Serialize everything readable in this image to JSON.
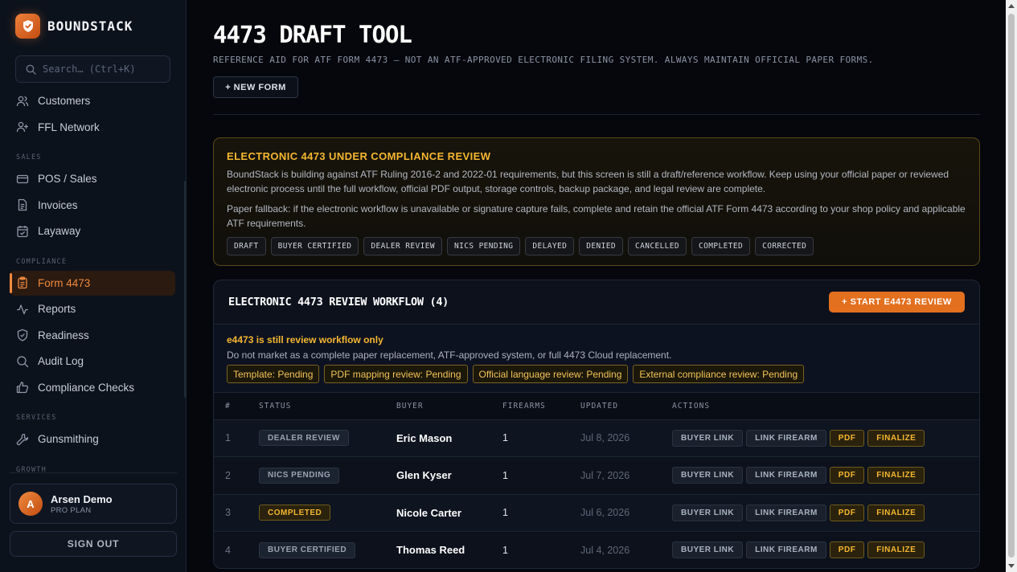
{
  "brand": {
    "name": "BOUNDSTACK"
  },
  "search": {
    "placeholder": "Search… (Ctrl+K)"
  },
  "nav": {
    "customers": "Customers",
    "ffl_network": "FFL Network",
    "section_sales": "SALES",
    "pos": "POS / Sales",
    "invoices": "Invoices",
    "layaway": "Layaway",
    "section_compliance": "COMPLIANCE",
    "form4473": "Form 4473",
    "reports": "Reports",
    "readiness": "Readiness",
    "audit_log": "Audit Log",
    "compliance_checks": "Compliance Checks",
    "section_services": "SERVICES",
    "gunsmithing": "Gunsmithing",
    "section_growth": "GROWTH"
  },
  "user": {
    "initial": "A",
    "name": "Arsen Demo",
    "plan": "PRO PLAN",
    "signout": "SIGN OUT"
  },
  "page": {
    "title": "4473 DRAFT TOOL",
    "subtitle": "REFERENCE AID FOR ATF FORM 4473 — NOT AN ATF-APPROVED ELECTRONIC FILING SYSTEM. ALWAYS MAINTAIN OFFICIAL PAPER FORMS.",
    "new_form": "+ NEW FORM"
  },
  "review_banner": {
    "title": "ELECTRONIC 4473 UNDER COMPLIANCE REVIEW",
    "text1": "BoundStack is building against ATF Ruling 2016-2 and 2022-01 requirements, but this screen is still a draft/reference workflow. Keep using your official paper or reviewed electronic process until the full workflow, official PDF output, storage controls, backup package, and legal review are complete.",
    "text2": "Paper fallback: if the electronic workflow is unavailable or signature capture fails, complete and retain the official ATF Form 4473 according to your shop policy and applicable ATF requirements.",
    "chips": [
      "DRAFT",
      "BUYER CERTIFIED",
      "DEALER REVIEW",
      "NICS PENDING",
      "DELAYED",
      "DENIED",
      "CANCELLED",
      "COMPLETED",
      "CORRECTED"
    ]
  },
  "workflow": {
    "title": "ELECTRONIC 4473 REVIEW WORKFLOW (4)",
    "start_button": "+ START E4473 REVIEW",
    "note_title": "e4473 is still review workflow only",
    "note_text": "Do not market as a complete paper replacement, ATF-approved system, or full 4473 Cloud replacement.",
    "pending": [
      "Template: Pending",
      "PDF mapping review: Pending",
      "Official language review: Pending",
      "External compliance review: Pending"
    ],
    "columns": [
      "#",
      "STATUS",
      "BUYER",
      "FIREARMS",
      "UPDATED",
      "ACTIONS"
    ],
    "actions": [
      "BUYER LINK",
      "LINK FIREARM",
      "PDF",
      "FINALIZE"
    ],
    "rows": [
      {
        "num": "1",
        "status": "DEALER REVIEW",
        "buyer": "Eric Mason",
        "firearms": "1",
        "updated": "Jul 8, 2026"
      },
      {
        "num": "2",
        "status": "NICS PENDING",
        "buyer": "Glen Kyser",
        "firearms": "1",
        "updated": "Jul 7, 2026"
      },
      {
        "num": "3",
        "status": "COMPLETED",
        "buyer": "Nicole Carter",
        "firearms": "1",
        "updated": "Jul 6, 2026"
      },
      {
        "num": "4",
        "status": "BUYER CERTIFIED",
        "buyer": "Thomas Reed",
        "firearms": "1",
        "updated": "Jul 4, 2026"
      }
    ]
  },
  "colors": {
    "accent": "#e2701f",
    "warning": "#f5b731",
    "background": "#05070c",
    "sidebar": "#0c121c"
  }
}
